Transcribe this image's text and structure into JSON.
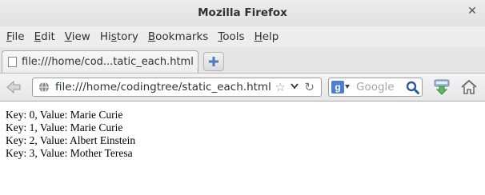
{
  "window": {
    "title": "Mozilla Firefox",
    "close_glyph": "✕"
  },
  "menu": {
    "items": [
      {
        "label": "File",
        "underline": "F",
        "rest": "ile"
      },
      {
        "label": "Edit",
        "underline": "E",
        "rest": "dit"
      },
      {
        "label": "View",
        "underline": "V",
        "rest": "iew"
      },
      {
        "label": "History",
        "underline": "s",
        "rest": "tory",
        "prefix": "Hi"
      },
      {
        "label": "Bookmarks",
        "underline": "B",
        "rest": "ookmarks"
      },
      {
        "label": "Tools",
        "underline": "T",
        "rest": "ools"
      },
      {
        "label": "Help",
        "underline": "H",
        "rest": "elp"
      }
    ]
  },
  "tabs": {
    "active": {
      "title": "file:///home/cod...tatic_each.html",
      "icon": "blank-page-icon"
    },
    "new_tab_icon": "plus-icon"
  },
  "navbar": {
    "back_icon": "back-arrow-icon",
    "url": "file:///home/codingtree/static_each.html",
    "url_icon": "globe-icon",
    "bookmark_icon": "star-icon",
    "bookmark_glyph": "☆",
    "dropdown_icon": "chevron-down-icon",
    "dropdown_glyph": "⌄",
    "reload_icon": "reload-icon",
    "reload_glyph": "↻",
    "search": {
      "engine_letter": "g",
      "engine_icon": "google-icon",
      "placeholder": "Google",
      "go_icon": "magnifier-icon"
    },
    "downloads_icon": "downloads-icon",
    "home_icon": "home-icon"
  },
  "page": {
    "lines": [
      "Key: 0, Value: Marie Curie",
      "Key: 1, Value: Marie Curie",
      "Key: 2, Value: Albert Einstein",
      "Key: 3, Value: Mother Teresa"
    ]
  }
}
